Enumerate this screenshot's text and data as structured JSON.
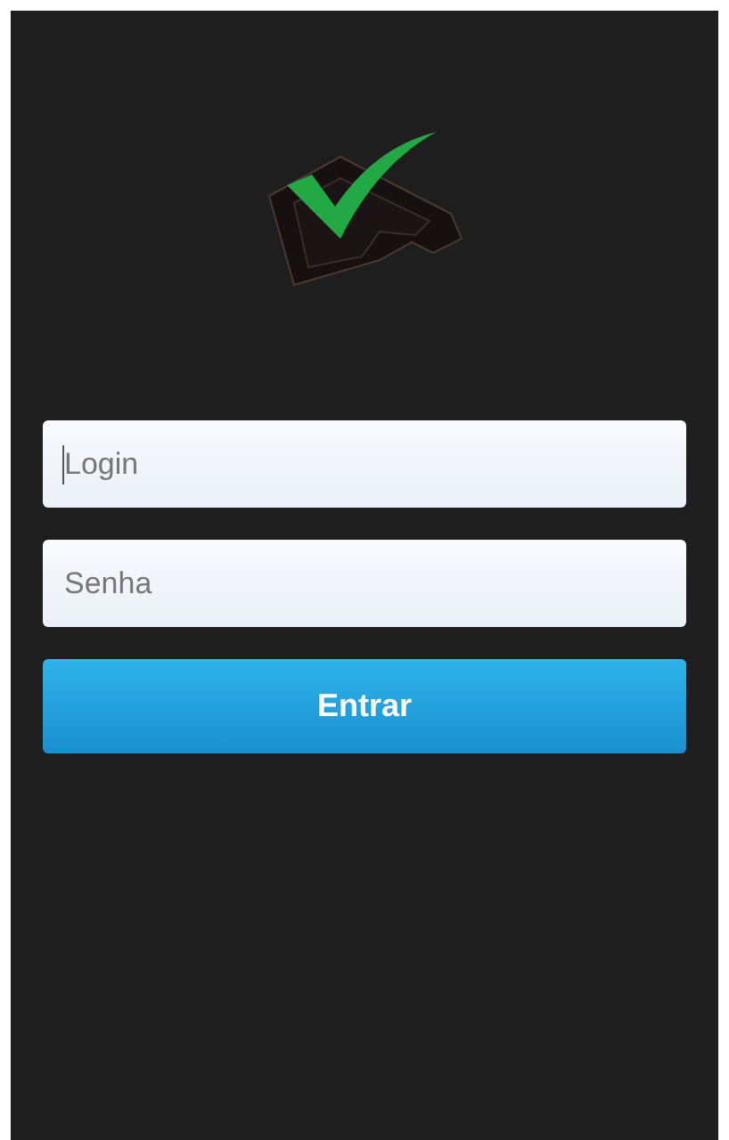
{
  "fields": [
    {
      "placeholder": "Login",
      "focused": true
    },
    {
      "placeholder": "Senha",
      "focused": false
    }
  ],
  "button": {
    "label": "Entrar"
  }
}
